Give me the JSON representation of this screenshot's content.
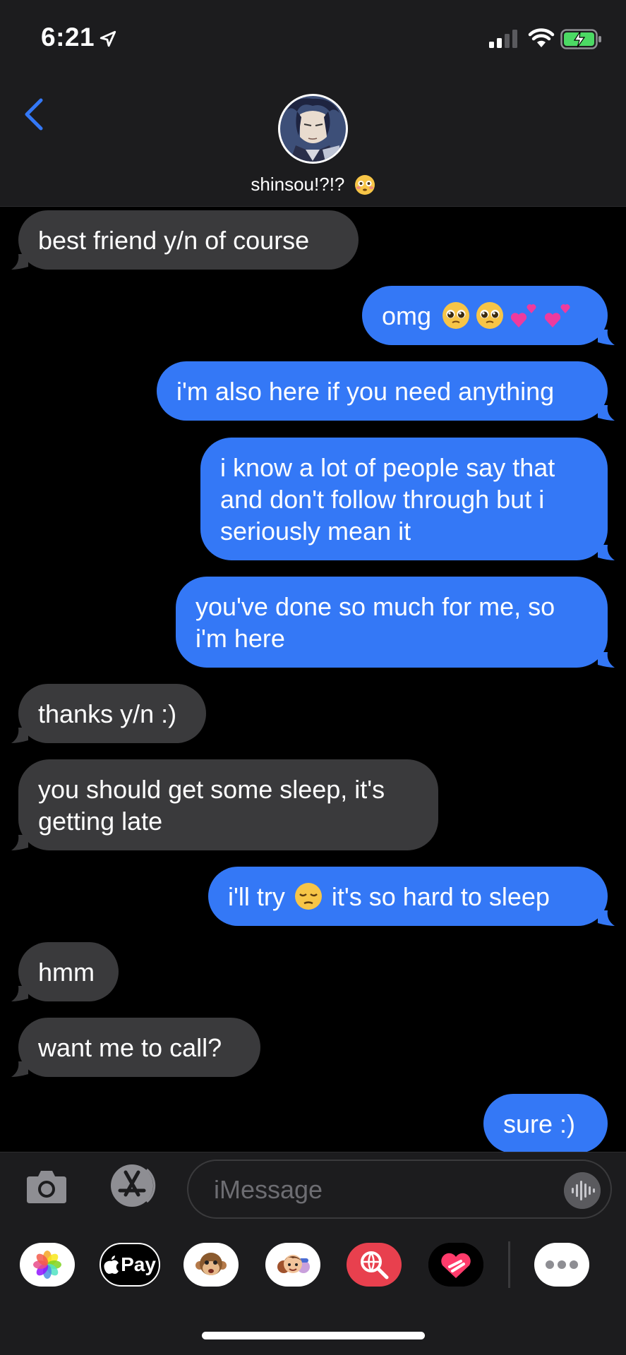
{
  "status_bar": {
    "time": "6:21"
  },
  "header": {
    "contact_name": "shinsou!?!?",
    "contact_emoji": "flushed-face"
  },
  "messages": [
    {
      "side": "in",
      "text": "best friend y/n of course"
    },
    {
      "side": "out",
      "text": "omg",
      "emojis": [
        "pleading-face",
        "pleading-face",
        "two-hearts",
        "two-hearts"
      ]
    },
    {
      "side": "out",
      "text": "i'm also here if you need anything"
    },
    {
      "side": "out",
      "text": "i know a lot of people say that\nand don't follow through but i\nseriously mean it"
    },
    {
      "side": "out",
      "text": "you've done so much for me, so\ni'm here"
    },
    {
      "side": "in",
      "text": "thanks y/n :)"
    },
    {
      "side": "in",
      "text": "you should get some sleep, it's\ngetting late"
    },
    {
      "side": "out",
      "text_before": "i'll try",
      "emoji": "pensive-face",
      "text_after": "it's so hard to sleep"
    },
    {
      "side": "in",
      "text": "hmm"
    },
    {
      "side": "in",
      "text": "want me to call?"
    },
    {
      "side": "out",
      "text": "sure :)"
    }
  ],
  "input": {
    "placeholder": "iMessage"
  },
  "app_drawer": {
    "apple_pay_label": "Pay",
    "apps": [
      "photos-icon",
      "apple-pay-icon",
      "animoji-icon",
      "memoji-icon",
      "image-search-icon",
      "digital-touch-icon",
      "more-icon"
    ]
  },
  "colors": {
    "outgoing_bubble": "#3478f6",
    "incoming_bubble": "#3a3a3c",
    "header_bg": "#1c1c1e",
    "accent": "#3478f6"
  }
}
